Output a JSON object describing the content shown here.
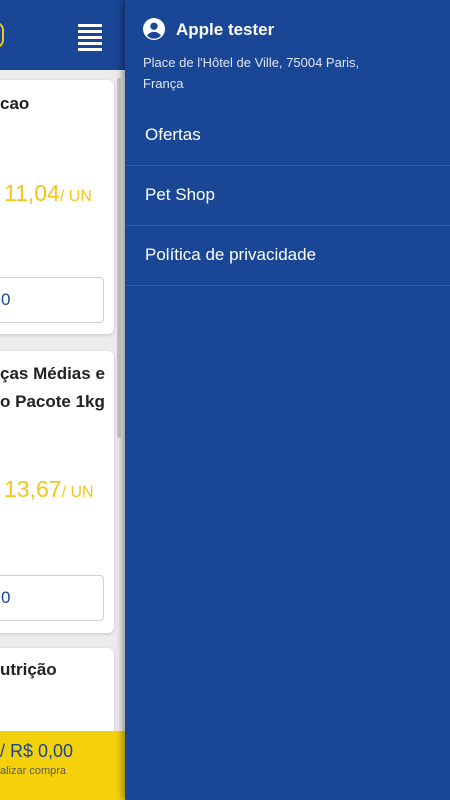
{
  "app": {
    "cards": [
      {
        "title_lines": [
          "cao"
        ],
        "price": "11,04",
        "unit": "/ UN",
        "qty": "0"
      },
      {
        "title_lines": [
          "ças Médias e",
          "o Pacote 1kg"
        ],
        "price": "13,67",
        "unit": "/ UN",
        "qty": "0"
      },
      {
        "title_lines": [
          "utrição"
        ]
      }
    ],
    "cart": {
      "total": "/ R$ 0,00",
      "subtitle": "alizar compra"
    }
  },
  "drawer": {
    "user_name": "Apple tester",
    "address": "Place de l'Hôtel de Ville, 75004 Paris, França",
    "menu": [
      {
        "label": "Ofertas"
      },
      {
        "label": "Pet Shop"
      },
      {
        "label": "Política de privacidade"
      }
    ]
  },
  "colors": {
    "primary": "#1a4696",
    "accent": "#f5c518",
    "cart_bar": "#f5d10b"
  },
  "icons": [
    "hamburger-menu-icon",
    "account-circle-icon"
  ]
}
